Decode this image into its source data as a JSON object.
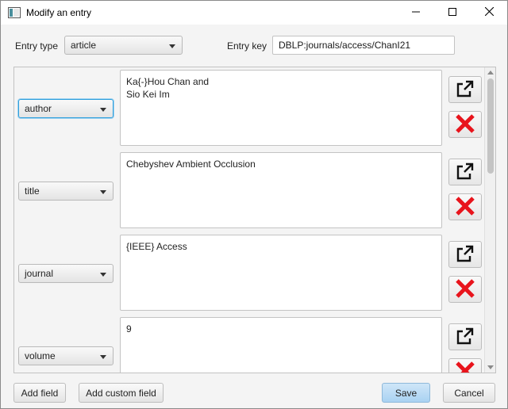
{
  "window": {
    "title": "Modify an entry",
    "controls": {
      "minimize": "minimize-icon",
      "maximize": "maximize-icon",
      "close": "close-icon"
    }
  },
  "header": {
    "entry_type_label": "Entry type",
    "entry_type_value": "article",
    "entry_key_label": "Entry key",
    "entry_key_value": "DBLP:journals/access/ChanI21"
  },
  "fields": [
    {
      "name": "author",
      "value": "Ka{-}Hou Chan and\nSio Kei Im"
    },
    {
      "name": "title",
      "value": "Chebyshev Ambient Occlusion"
    },
    {
      "name": "journal",
      "value": "{IEEE} Access"
    },
    {
      "name": "volume",
      "value": "9"
    }
  ],
  "row_icons": {
    "open": "open-external-icon",
    "delete": "delete-x-icon"
  },
  "footer": {
    "add_field": "Add field",
    "add_custom_field": "Add custom field",
    "save": "Save",
    "cancel": "Cancel"
  },
  "colors": {
    "accent": "#2f9fdc",
    "delete_red": "#e8141c",
    "save_bg": "#a9d2f2"
  }
}
